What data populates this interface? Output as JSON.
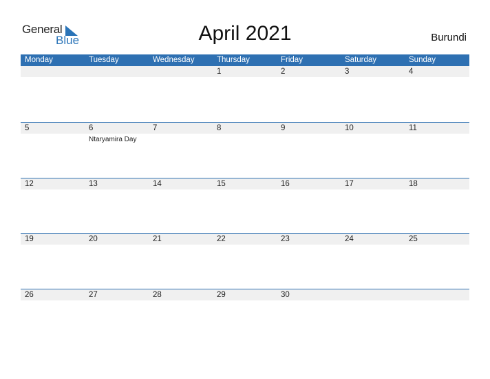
{
  "brand": {
    "word1": "General",
    "word2": "Blue",
    "accent": "#2a74b8"
  },
  "title": "April 2021",
  "country": "Burundi",
  "header_color": "#2e70b2",
  "weekdays": [
    "Monday",
    "Tuesday",
    "Wednesday",
    "Thursday",
    "Friday",
    "Saturday",
    "Sunday"
  ],
  "weeks": [
    {
      "days": [
        "",
        "",
        "",
        "1",
        "2",
        "3",
        "4"
      ],
      "events": [
        "",
        "",
        "",
        "",
        "",
        "",
        ""
      ]
    },
    {
      "days": [
        "5",
        "6",
        "7",
        "8",
        "9",
        "10",
        "11"
      ],
      "events": [
        "",
        "Ntaryamira Day",
        "",
        "",
        "",
        "",
        ""
      ]
    },
    {
      "days": [
        "12",
        "13",
        "14",
        "15",
        "16",
        "17",
        "18"
      ],
      "events": [
        "",
        "",
        "",
        "",
        "",
        "",
        ""
      ]
    },
    {
      "days": [
        "19",
        "20",
        "21",
        "22",
        "23",
        "24",
        "25"
      ],
      "events": [
        "",
        "",
        "",
        "",
        "",
        "",
        ""
      ]
    },
    {
      "days": [
        "26",
        "27",
        "28",
        "29",
        "30",
        "",
        ""
      ],
      "events": [
        "",
        "",
        "",
        "",
        "",
        "",
        ""
      ]
    }
  ]
}
